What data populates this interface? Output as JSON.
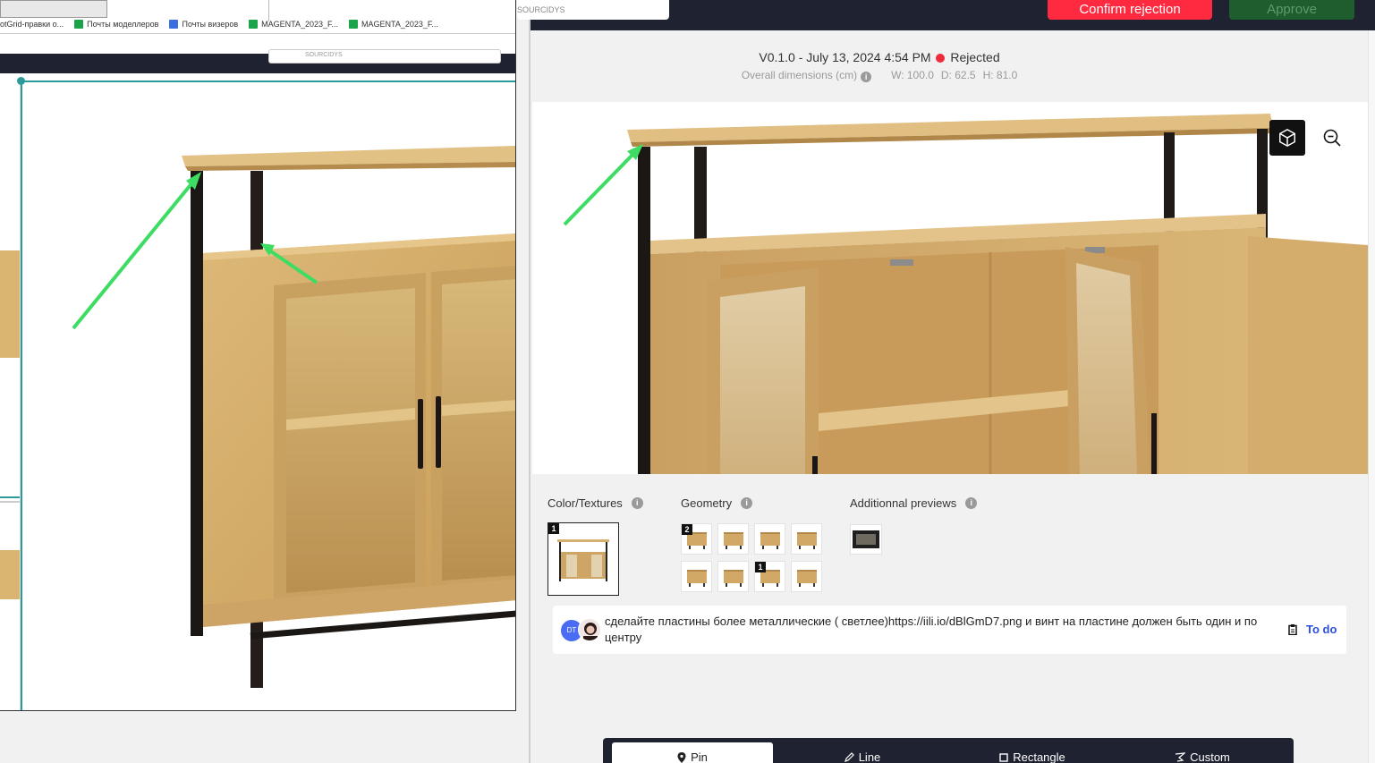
{
  "left_window": {
    "search_text": "SOURCIDYS",
    "bookmarks": [
      {
        "label": "otGrid-правки о...",
        "color": "#ffffff"
      },
      {
        "label": "Почты моделлеров",
        "color": "#1aa34a"
      },
      {
        "label": "Почты визеров",
        "color": "#3b6fe0"
      },
      {
        "label": "MAGENTA_2023_F...",
        "color": "#1aa34a"
      },
      {
        "label": "MAGENTA_2023_F...",
        "color": "#1aa34a"
      }
    ]
  },
  "header": {
    "search_text": "SOURCIDYS",
    "confirm_label": "Confirm rejection",
    "approve_label": "Approve"
  },
  "version": {
    "label": "V0.1.0 - July 13, 2024 4:54 PM",
    "status": "Rejected",
    "status_color": "#ef2b3b"
  },
  "dimensions": {
    "label": "Overall dimensions (cm)",
    "width": "W: 100.0",
    "depth": "D: 62.5",
    "height": "H: 81.0"
  },
  "viewer": {
    "icons": [
      "cube-icon",
      "zoom-out-icon"
    ]
  },
  "sections": {
    "color_textures": {
      "title": "Color/Textures",
      "badges": [
        "1"
      ]
    },
    "geometry": {
      "title": "Geometry",
      "badges": [
        "2",
        "",
        "",
        "",
        "",
        "",
        "1",
        ""
      ]
    },
    "additional": {
      "title": "Additionnal previews"
    }
  },
  "comment": {
    "avatar_initials": "DT",
    "text": "сделайте пластины более металлические ( светлее)https://iili.io/dBlGmD7.png и винт на пластине должен быть один и по центру",
    "status": "To do"
  },
  "toolbar": {
    "pin": "Pin",
    "line": "Line",
    "rectangle": "Rectangle",
    "custom": "Custom"
  },
  "colors": {
    "topbar": "#1f2230",
    "confirm": "#ff2a3f",
    "approve": "#1f5d2e",
    "accent_blue": "#2a4fe0",
    "annotation_arrow": "#3ddc63",
    "wood": "#d6b06b"
  }
}
